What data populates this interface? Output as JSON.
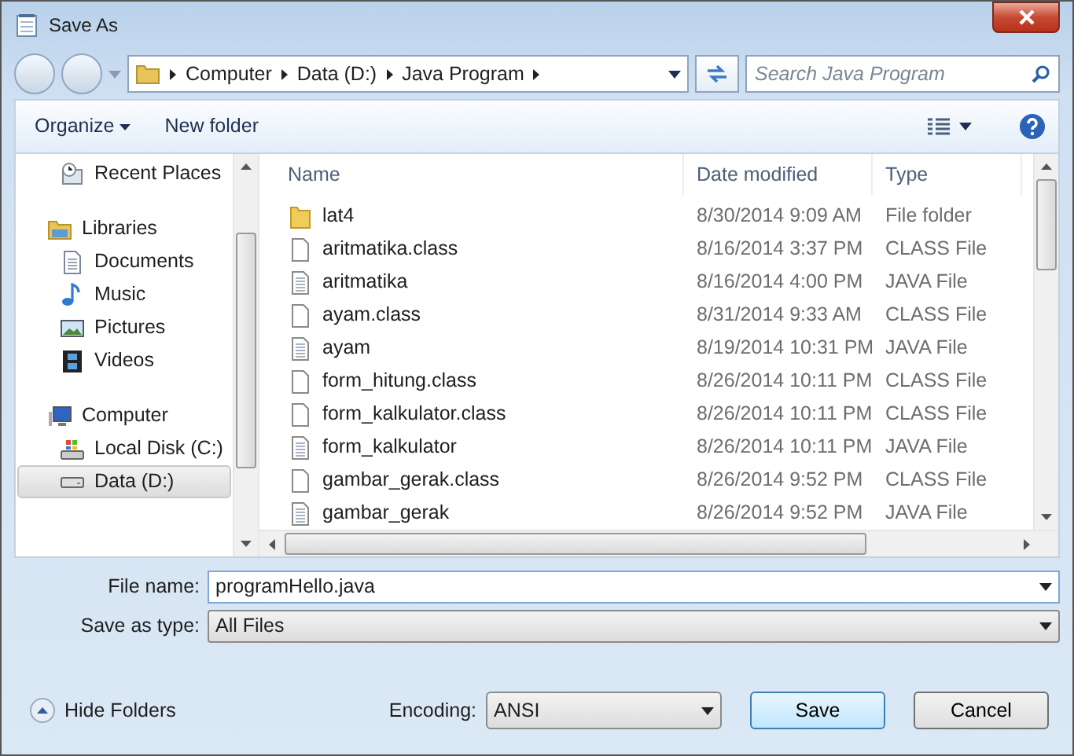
{
  "window": {
    "title": "Save As"
  },
  "address": {
    "crumbs": [
      "Computer",
      "Data (D:)",
      "Java Program"
    ]
  },
  "search": {
    "placeholder": "Search Java Program"
  },
  "toolbar": {
    "organize": "Organize",
    "new_folder": "New folder"
  },
  "sidebar": {
    "items": [
      {
        "label": "Recent Places",
        "kind": "recent",
        "selected": false
      },
      {
        "label": "Libraries",
        "kind": "libraries",
        "selected": false,
        "children": [
          {
            "label": "Documents",
            "kind": "documents",
            "selected": false
          },
          {
            "label": "Music",
            "kind": "music",
            "selected": false
          },
          {
            "label": "Pictures",
            "kind": "pictures",
            "selected": false
          },
          {
            "label": "Videos",
            "kind": "videos",
            "selected": false
          }
        ]
      },
      {
        "label": "Computer",
        "kind": "computer",
        "selected": false,
        "children": [
          {
            "label": "Local Disk (C:)",
            "kind": "sysdisk",
            "selected": false
          },
          {
            "label": "Data (D:)",
            "kind": "drive",
            "selected": true
          }
        ]
      }
    ]
  },
  "files": {
    "columns": [
      "Name",
      "Date modified",
      "Type"
    ],
    "rows": [
      {
        "name": "lat4",
        "date": "8/30/2014 9:09 AM",
        "type": "File folder",
        "kind": "folder"
      },
      {
        "name": "aritmatika.class",
        "date": "8/16/2014 3:37 PM",
        "type": "CLASS File",
        "kind": "blank"
      },
      {
        "name": "aritmatika",
        "date": "8/16/2014 4:00 PM",
        "type": "JAVA File",
        "kind": "text"
      },
      {
        "name": "ayam.class",
        "date": "8/31/2014 9:33 AM",
        "type": "CLASS File",
        "kind": "blank"
      },
      {
        "name": "ayam",
        "date": "8/19/2014 10:31 PM",
        "type": "JAVA File",
        "kind": "text"
      },
      {
        "name": "form_hitung.class",
        "date": "8/26/2014 10:11 PM",
        "type": "CLASS File",
        "kind": "blank"
      },
      {
        "name": "form_kalkulator.class",
        "date": "8/26/2014 10:11 PM",
        "type": "CLASS File",
        "kind": "blank"
      },
      {
        "name": "form_kalkulator",
        "date": "8/26/2014 10:11 PM",
        "type": "JAVA File",
        "kind": "text"
      },
      {
        "name": "gambar_gerak.class",
        "date": "8/26/2014 9:52 PM",
        "type": "CLASS File",
        "kind": "blank"
      },
      {
        "name": "gambar_gerak",
        "date": "8/26/2014 9:52 PM",
        "type": "JAVA File",
        "kind": "text"
      }
    ]
  },
  "form": {
    "file_name_label": "File name:",
    "file_name": "programHello.java",
    "type_label": "Save as type:",
    "type": "All Files"
  },
  "footer": {
    "hide_folders": "Hide Folders",
    "encoding_label": "Encoding:",
    "encoding": "ANSI",
    "save": "Save",
    "cancel": "Cancel"
  }
}
